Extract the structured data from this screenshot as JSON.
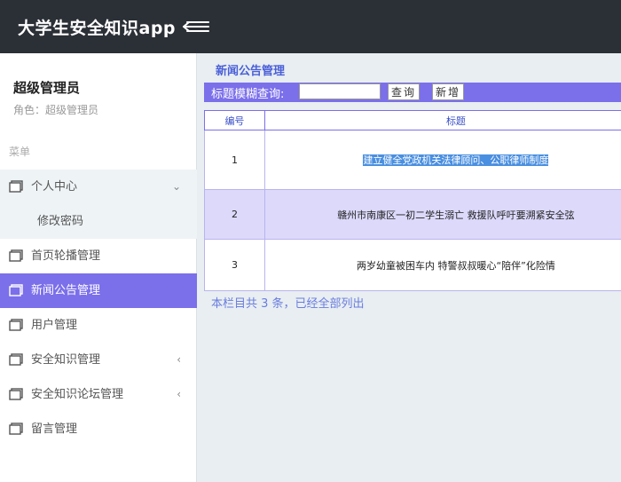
{
  "header": {
    "app_title": "大学生安全知识app"
  },
  "sidebar": {
    "user_name": "超级管理员",
    "user_role": "角色：超级管理员",
    "menu_heading": "菜单",
    "items": [
      {
        "label": "个人中心",
        "icon": "window-icon",
        "arrow": "⌄"
      },
      {
        "label": "修改密码"
      },
      {
        "label": "首页轮播管理",
        "icon": "window-icon"
      },
      {
        "label": "新闻公告管理",
        "icon": "window-icon"
      },
      {
        "label": "用户管理",
        "icon": "window-icon"
      },
      {
        "label": "安全知识管理",
        "icon": "window-icon",
        "arrow": "‹"
      },
      {
        "label": "安全知识论坛管理",
        "icon": "window-icon",
        "arrow": "‹"
      },
      {
        "label": "留言管理",
        "icon": "window-icon"
      }
    ]
  },
  "main": {
    "section_title": "新闻公告管理",
    "search": {
      "label": "标题模糊查询:",
      "value": "",
      "search_button": "查询",
      "add_button": "新增"
    },
    "table": {
      "columns": [
        "编号",
        "标题"
      ],
      "rows": [
        {
          "id": "1",
          "title": "建立健全党政机关法律顾问、公职律师制度"
        },
        {
          "id": "2",
          "title": "赣州市南康区一初二学生溺亡 救援队呼吁要溯紧安全弦"
        },
        {
          "id": "3",
          "title": "两岁幼童被困车内 特警叔叔暖心“陪伴”化险情"
        }
      ]
    },
    "footer": "本栏目共 3 条，已经全部列出"
  },
  "colors": {
    "topbar": "#2b2f36",
    "accent": "#7b6fea",
    "row_highlight": "#dcd9fb",
    "selection": "#4a8fe0"
  }
}
